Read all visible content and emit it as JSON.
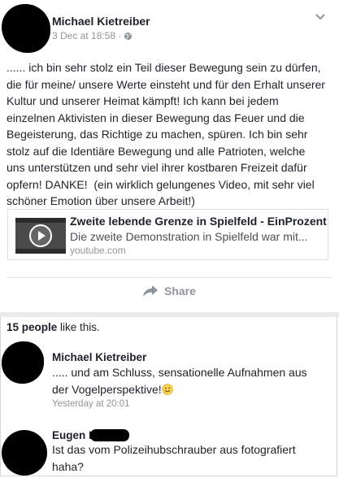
{
  "post": {
    "author": "Michael Kietreiber",
    "date": "3 Dec at 18:58",
    "meta_separator": "·",
    "privacy_icon": "globe-icon",
    "menu_icon": "chevron-down-icon",
    "text": "...... ich bin sehr stolz ein Teil dieser Bewegung sein zu dürfen,\ndie für meine/ unsere Werte einsteht und für den Erhalt unserer\nKultur und unserer Heimat kämpft! Ich kann bei jedem\neinzelnen Aktivisten in dieser Bewegung das Feuer und die\nBegeisterung, das Richtige zu machen, spüren. Ich bin sehr\nstolz auf die Identiäre Bewegung und alle Patrioten, welche\nuns unterstützen und sehr viel ihrer kostbaren Freizeit dafür\nopfern! DANKE!  (ein wirklich gelungenes Video, mit sehr viel\nschöner Emotion über unsere Arbeit!)",
    "link": {
      "title": "Zweite lebende Grenze in Spielfeld - EinProzent",
      "description": "Die zweite Demonstration in Spielfeld war mit...",
      "domain": "youtube.com",
      "thumbnail_icon": "play-icon"
    },
    "share_label": "Share"
  },
  "likes": {
    "count": "15 people",
    "suffix": " like this."
  },
  "comments": [
    {
      "author": "Michael Kietreiber",
      "text": "..... und am Schluss, sensationelle Aufnahmen aus\nder Vogelperspektive!",
      "emoji_icon": "smiley-icon",
      "time": "Yesterday at 20:01"
    },
    {
      "author": "Eugen L",
      "text": "Ist das vom Polizeihubschrauber aus fotografiert\nhaha?"
    }
  ],
  "colors": {
    "text": "#1d2129",
    "muted": "#90949c",
    "border": "#dddfe2",
    "background": "#ffffff"
  }
}
